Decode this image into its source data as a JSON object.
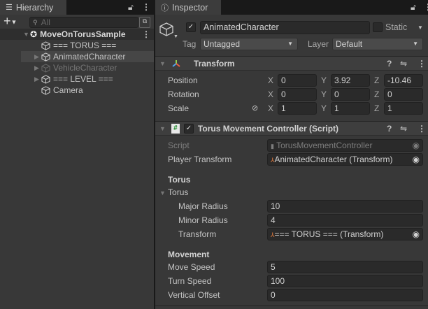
{
  "hierarchy": {
    "tab_label": "Hierarchy",
    "search_placeholder": "All",
    "scene_name": "MoveOnTorusSample",
    "items": [
      {
        "label": "=== TORUS ===",
        "expandable": false,
        "selected": false,
        "disabled": false
      },
      {
        "label": "AnimatedCharacter",
        "expandable": true,
        "selected": true,
        "disabled": false
      },
      {
        "label": "VehicleCharacter",
        "expandable": true,
        "selected": false,
        "disabled": true
      },
      {
        "label": "=== LEVEL ===",
        "expandable": true,
        "selected": false,
        "disabled": false
      },
      {
        "label": "Camera",
        "expandable": false,
        "selected": false,
        "disabled": false
      }
    ]
  },
  "inspector": {
    "tab_label": "Inspector",
    "object_name": "AnimatedCharacter",
    "active": true,
    "static_label": "Static",
    "tag_label": "Tag",
    "tag_value": "Untagged",
    "layer_label": "Layer",
    "layer_value": "Default",
    "transform": {
      "title": "Transform",
      "rows": [
        {
          "label": "Position",
          "x": "0",
          "y": "3.92",
          "z": "-10.46"
        },
        {
          "label": "Rotation",
          "x": "0",
          "y": "0",
          "z": "0"
        },
        {
          "label": "Scale",
          "x": "1",
          "y": "1",
          "z": "1"
        }
      ],
      "axes": [
        "X",
        "Y",
        "Z"
      ]
    },
    "script_component": {
      "title": "Torus Movement Controller (Script)",
      "enabled": true,
      "script_label": "Script",
      "script_value": "TorusMovementController",
      "player_transform_label": "Player Transform",
      "player_transform_value": "AnimatedCharacter (Transform)",
      "torus_header": "Torus",
      "torus_foldout": "Torus",
      "major_radius_label": "Major Radius",
      "major_radius": "10",
      "minor_radius_label": "Minor Radius",
      "minor_radius": "4",
      "torus_transform_label": "Transform",
      "torus_transform_value": "=== TORUS === (Transform)",
      "movement_header": "Movement",
      "move_speed_label": "Move Speed",
      "move_speed": "5",
      "turn_speed_label": "Turn Speed",
      "turn_speed": "100",
      "vertical_offset_label": "Vertical Offset",
      "vertical_offset": "0"
    }
  }
}
